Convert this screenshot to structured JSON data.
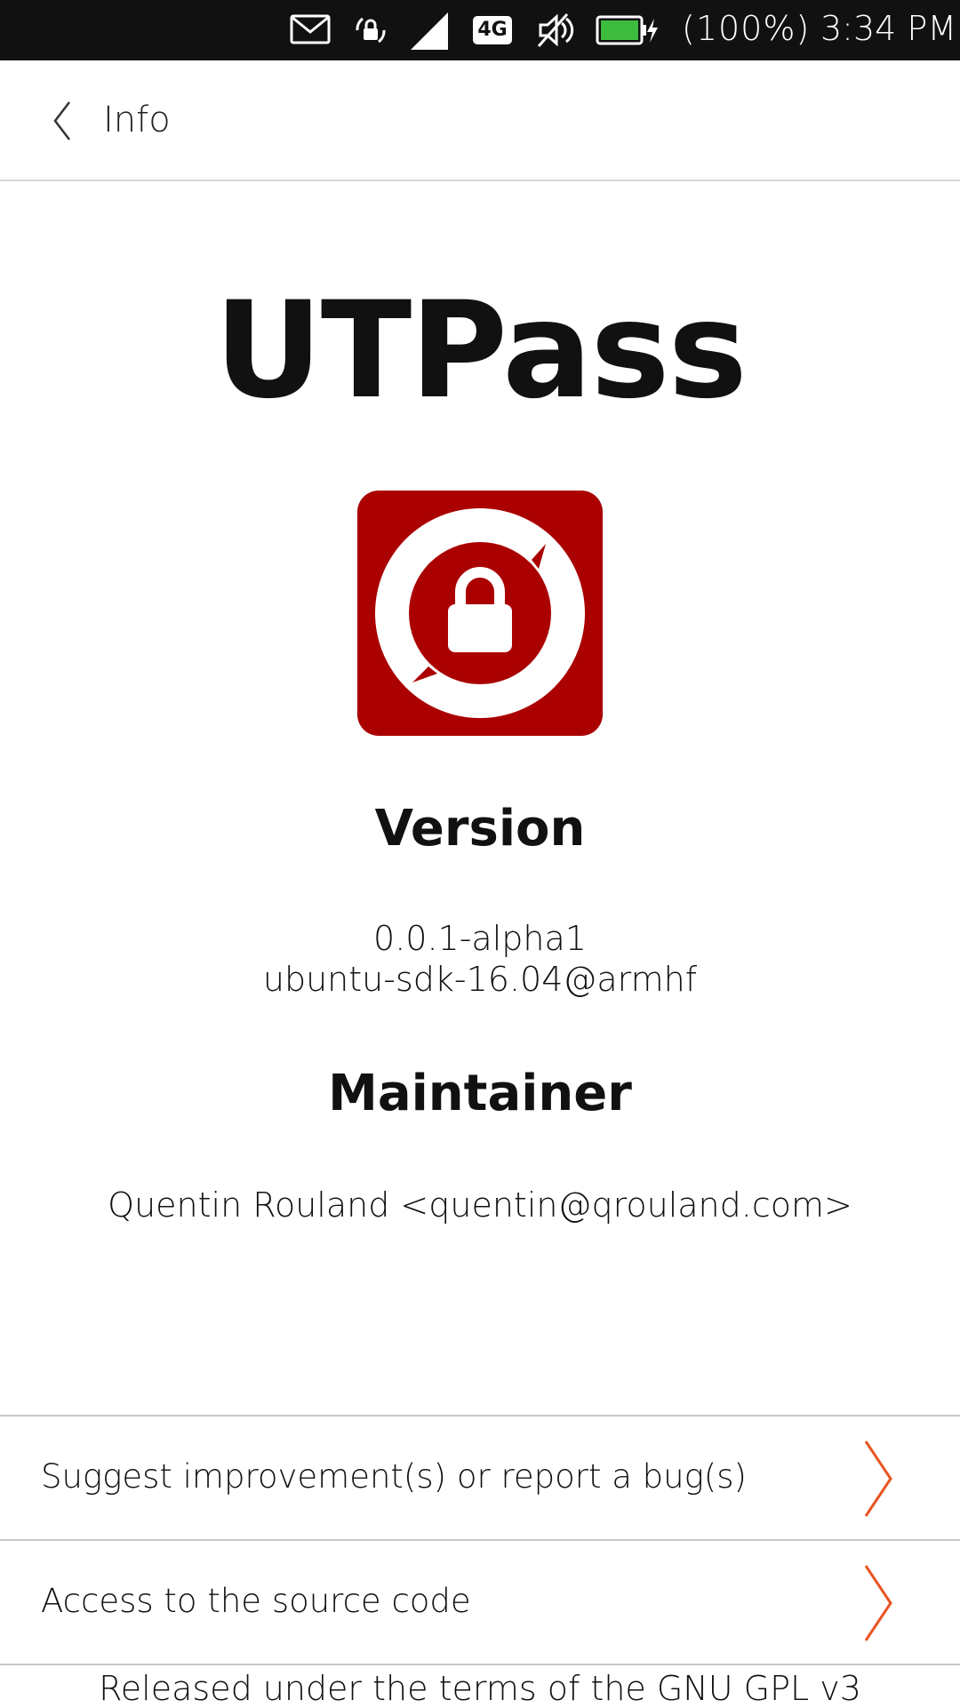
{
  "status_bar": {
    "icons": [
      "mail-icon",
      "rotation-lock-icon",
      "signal-icon",
      "4g-icon",
      "mute-icon",
      "battery-charging-icon"
    ],
    "network_label": "4G",
    "battery_percent": "(100%)",
    "time": "3:34 PM",
    "battery_color": "#3dbb3d"
  },
  "header": {
    "title": "Info"
  },
  "app": {
    "name": "UTPass",
    "icon_color": "#aa0000"
  },
  "version": {
    "heading": "Version",
    "number": "0.0.1-alpha1",
    "build": "ubuntu-sdk-16.04@armhf"
  },
  "maintainer": {
    "heading": "Maintainer",
    "contact": "Quentin Rouland <quentin@qrouland.com>"
  },
  "links": [
    {
      "label": "Suggest improvement(s) or report a bug(s)"
    },
    {
      "label": "Access to the source code"
    }
  ],
  "footer": {
    "license": "Released under the terms of the GNU GPL v3"
  },
  "accent_color": "#e95420"
}
